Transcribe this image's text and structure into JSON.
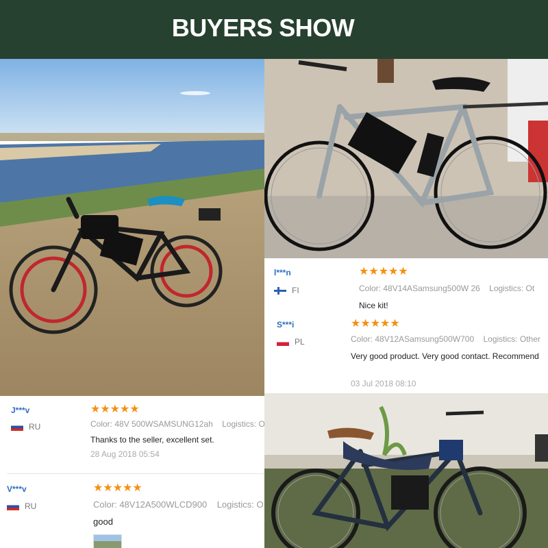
{
  "header": {
    "title": "BUYERS SHOW"
  },
  "reviews_top_right": [
    {
      "user": "l***n",
      "country": "FI",
      "stars": "★★★★★",
      "color_label": "Color:",
      "color_value": "48V14ASamsung500W 26",
      "logistics_label": "Logistics:",
      "logistics_value": "Ot",
      "comment": "Nice kit!",
      "date": ""
    },
    {
      "user": "S***i",
      "country": "PL",
      "stars": "★★★★★",
      "color_label": "Color:",
      "color_value": "48V12ASamsung500W700",
      "logistics_label": "Logistics:",
      "logistics_value": "Other",
      "comment": "Very good product. Very good contact. Recommend",
      "date": "03 Jul 2018 08:10"
    }
  ],
  "reviews_bottom_left": [
    {
      "user": "J***v",
      "country": "RU",
      "stars": "★★★★★",
      "color_label": "Color:",
      "color_value": "48V 500WSAMSUNG12ah",
      "logistics_label": "Logistics:",
      "logistics_value": "O",
      "comment": "Thanks to the seller, excellent set.",
      "date": "28 Aug 2018 05:54"
    },
    {
      "user": "V***v",
      "country": "RU",
      "stars": "★★★★★",
      "color_label": "Color:",
      "color_value": "48V12A500WLCD900",
      "logistics_label": "Logistics:",
      "logistics_value": "O",
      "comment": "good",
      "date": ""
    }
  ],
  "colors": {
    "header_bg": "#26412f",
    "star": "#f5900f",
    "username": "#2b6fc2"
  }
}
